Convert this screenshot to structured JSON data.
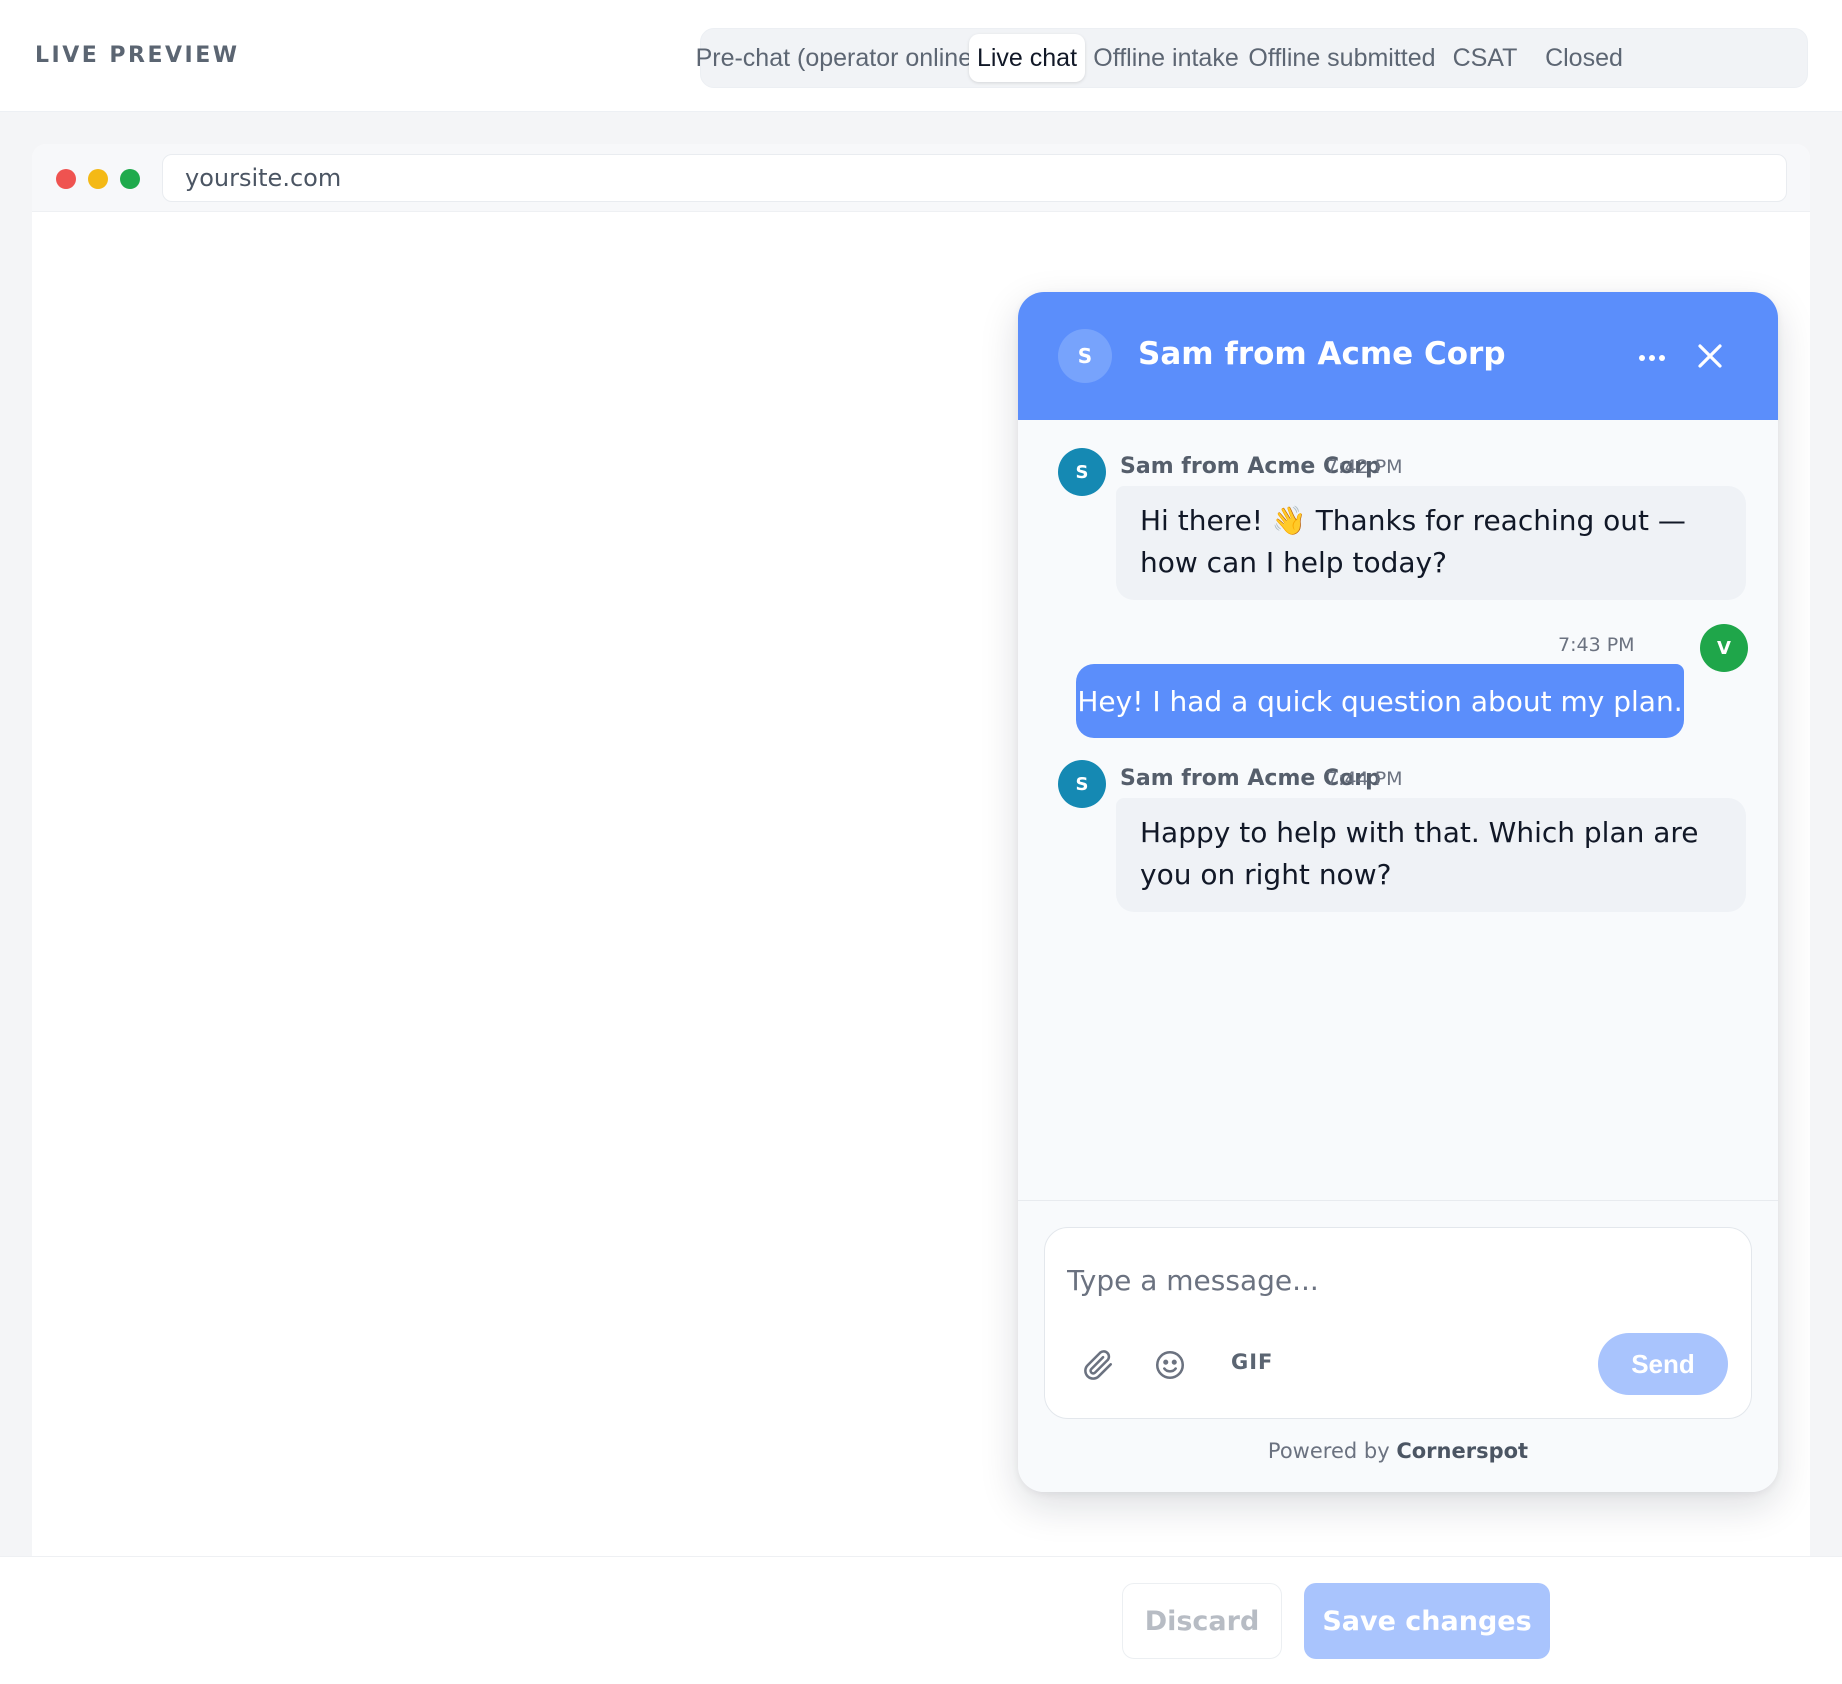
{
  "header": {
    "title": "LIVE PREVIEW",
    "tabs": [
      {
        "label": "Pre-chat (operator online)",
        "active": false
      },
      {
        "label": "Live chat",
        "active": true
      },
      {
        "label": "Offline intake",
        "active": false
      },
      {
        "label": "Offline submitted",
        "active": false
      },
      {
        "label": "CSAT",
        "active": false
      },
      {
        "label": "Closed",
        "active": false
      }
    ]
  },
  "browser": {
    "url": "yoursite.com"
  },
  "widget": {
    "avatar_initial": "S",
    "title": "Sam from Acme Corp",
    "icons": {
      "more": "more-horizontal-icon",
      "close": "close-icon"
    },
    "messages": [
      {
        "from": "operator",
        "name": "Sam from Acme Corp",
        "time": "7:42 PM",
        "initial": "S",
        "text": "Hi there! 👋 Thanks for reaching out — how can I help today?"
      },
      {
        "from": "visitor",
        "time": "7:43 PM",
        "initial": "V",
        "text": "Hey! I had a quick question about my plan."
      },
      {
        "from": "operator",
        "name": "Sam from Acme Corp",
        "time": "7:44 PM",
        "initial": "S",
        "text": "Happy to help with that. Which plan are you on right now?"
      }
    ],
    "composer": {
      "placeholder": "Type a message...",
      "gif_label": "GIF",
      "send_label": "Send",
      "icons": {
        "attach": "paperclip-icon",
        "emoji": "smiley-icon"
      }
    },
    "powered_by_prefix": "Powered by",
    "powered_by_brand": "Cornerspot"
  },
  "actions": {
    "discard_label": "Discard",
    "save_label": "Save changes"
  },
  "colors": {
    "accent": "#5b8efb",
    "accent_disabled": "#a9c4fd",
    "operator_avatar": "#1589b3",
    "visitor_avatar": "#1fa64a"
  }
}
